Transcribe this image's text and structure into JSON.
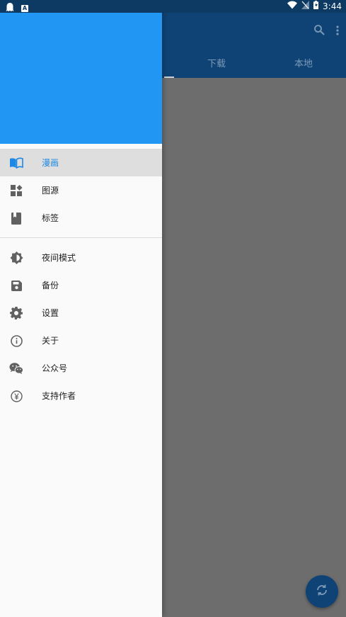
{
  "status_bar": {
    "time": "3:44",
    "notif_app_label": "A"
  },
  "background_app": {
    "tabs": [
      {
        "label": "下载"
      },
      {
        "label": "本地"
      }
    ],
    "accent": "#0f4375"
  },
  "drawer": {
    "header_color": "#2196f3",
    "primary_items": [
      {
        "label": "漫画",
        "icon": "book-open-icon",
        "selected": true
      },
      {
        "label": "图源",
        "icon": "widgets-icon",
        "selected": false
      },
      {
        "label": "标签",
        "icon": "bookmark-book-icon",
        "selected": false
      }
    ],
    "secondary_items": [
      {
        "label": "夜间模式",
        "icon": "brightness-icon"
      },
      {
        "label": "备份",
        "icon": "save-icon"
      },
      {
        "label": "设置",
        "icon": "gear-icon"
      },
      {
        "label": "关于",
        "icon": "info-icon"
      },
      {
        "label": "公众号",
        "icon": "wechat-icon"
      },
      {
        "label": "支持作者",
        "icon": "yen-coin-icon"
      }
    ]
  }
}
